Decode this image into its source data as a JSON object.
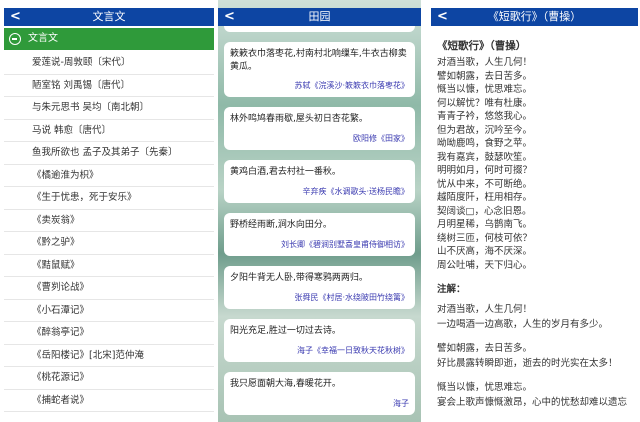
{
  "panel1": {
    "header": "文言文",
    "group": "文言文",
    "items": [
      "爱莲说-周敦颐〔宋代〕",
      "陋室铭 刘禹锡〔唐代〕",
      "与朱元思书 吴均〔南北朝〕",
      "马说 韩愈〔唐代〕",
      "鱼我所欲也 孟子及其弟子〔先秦〕",
      "《橘逾淮为枳》",
      "《生于忧患，死于安乐》",
      "《卖炭翁》",
      "《黔之驴》",
      "《黠鼠赋》",
      "《曹刿论战》",
      "《小石潭记》",
      "《醉翁亭记》",
      "《岳阳楼记》[北宋]范仲淹",
      "《桃花源记》",
      "《捕蛇者说》"
    ]
  },
  "panel2": {
    "header": "田园",
    "cards": [
      {
        "text": "簌簌衣巾落枣花,村南村北响缫车,牛衣古柳卖黄瓜。",
        "source": "苏轼《浣溪沙·簌簌衣巾落枣花》"
      },
      {
        "text": "林外鸣鸠春雨歇,屋头初日杏花繁。",
        "source": "欧阳修《田家》"
      },
      {
        "text": "黄鸡白酒,君去村社一番秋。",
        "source": "辛弃疾《水调歌头·送杨民瞻》"
      },
      {
        "text": "野桥经雨断,涧水向田分。",
        "source": "刘长卿《碧涧别墅喜皇甫侍御相访》"
      },
      {
        "text": "夕阳牛背无人卧,带得寒鸦两两归。",
        "source": "张舜民《村居·水绕陂田竹绕篱》"
      },
      {
        "text": "阳光充足,胜过一切过去诗。",
        "source": "海子《幸福一日致秋天花秋树》"
      },
      {
        "text": "我只愿面朝大海,春暖花开。",
        "source": "海子"
      }
    ]
  },
  "panel3": {
    "header": "《短歌行》（曹操）",
    "title": "《短歌行》（曹操）",
    "lines": [
      "对酒当歌，人生几何！",
      "譬如朝露，去日苦多。",
      "慨当以慷，忧思难忘。",
      "何以解忧？唯有杜康。",
      "青青子衿，悠悠我心。",
      "但为君故，沉吟至今。",
      "呦呦鹿鸣，食野之苹。",
      "我有嘉宾，鼓瑟吹笙。",
      "明明如月，何时可掇？",
      "忧从中来，不可断绝。",
      "越陌度阡，枉用相存。",
      "契阔谈□，心念旧恩。",
      "月明星稀，乌鹊南飞。",
      "绕树三匝，何枝可依？",
      "山不厌高，海不厌深。",
      "周公吐哺，天下归心。"
    ],
    "note_label": "注解：",
    "notes": [
      [
        "对酒当歌，人生几何！",
        "一边喝酒一边高歌，人生的岁月有多少。"
      ],
      [
        "譬如朝露，去日苦多。",
        "好比晨露转瞬即逝，逝去的时光实在太多！"
      ],
      [
        "慨当以慷，忧思难忘。",
        "宴会上歌声慷慨激昂，心中的忧愁却难以遗忘"
      ]
    ]
  }
}
